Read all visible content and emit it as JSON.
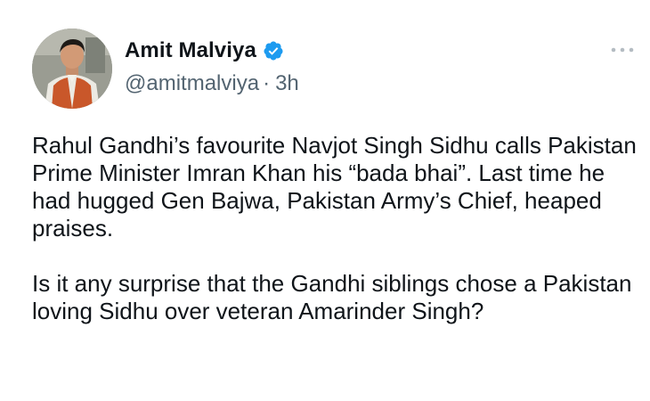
{
  "author": {
    "display_name": "Amit Malviya",
    "handle": "@amitmalviya",
    "separator": "·",
    "timestamp": "3h",
    "verified_icon": "verified-badge-icon",
    "avatar": "profile-photo"
  },
  "menu": {
    "icon": "more-horizontal-icon"
  },
  "tweet": {
    "paragraphs": [
      "Rahul Gandhi’s favourite Navjot Singh Sidhu calls Pakistan Prime Minister Imran Khan his “bada bhai”. Last time he had hugged Gen Bajwa, Pakistan Army’s Chief, heaped praises.",
      "Is it any surprise that the Gandhi siblings chose a Pakistan loving Sidhu over veteran Amarinder Singh?"
    ]
  },
  "colors": {
    "text_primary": "#0f1419",
    "text_secondary": "#536471",
    "verified_blue": "#1d9bf0",
    "background": "#ffffff"
  }
}
